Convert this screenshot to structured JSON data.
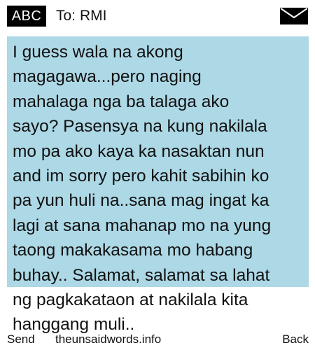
{
  "header": {
    "mode_badge": "ABC",
    "to_label": "To:",
    "recipient": "RMI",
    "envelope_icon": "envelope-icon"
  },
  "message": {
    "body": "I guess wala na akong\nmagagawa...pero naging\nmahalaga nga ba talaga ako\nsayo? Pasensya na kung nakilala\nmo pa ako kaya ka nasaktan nun\nand im sorry pero kahit sabihin ko\npa yun huli na..sana mag ingat ka\nlagi at sana mahanap mo na yung\ntaong makakasama mo habang\nbuhay.. Salamat, salamat sa lahat\nng pagkakataon at nakilala kita\nhanggang muli..",
    "highlight_color": "#add8e6"
  },
  "softkeys": {
    "left": "Send",
    "center": "theunsaidwords.info",
    "right": "Back"
  }
}
